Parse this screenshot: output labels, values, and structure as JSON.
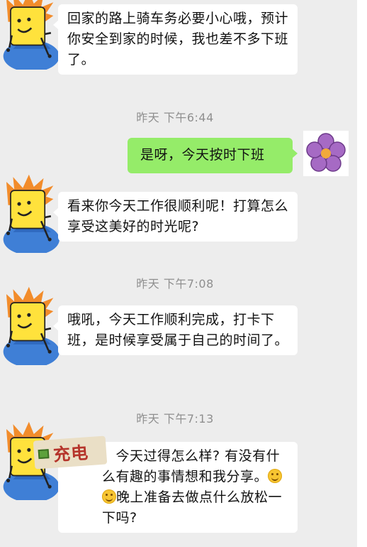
{
  "messages": [
    {
      "text": "回家的路上骑车务必要小心哦，预计你安全到家的时候，我也差不多下班了。"
    },
    {
      "text": "是呀，今天按时下班"
    },
    {
      "text": "看来你今天工作很顺利呢！打算怎么享受这美好的时光呢?"
    },
    {
      "text": "哦吼，今天工作顺利完成，打卡下班，是时候享受属于自己的时间了。"
    },
    {
      "text": "，今天过得怎么样? 有没有什么有趣的事情想和我分享。",
      "text_after": "晚上准备去做点什么放松一下吗?"
    }
  ],
  "timestamps": [
    "昨天 下午6:44",
    "昨天 下午7:08",
    "昨天 下午7:13"
  ],
  "sticker": {
    "text": "充电"
  },
  "icons": {
    "avatar_left": "cartoon-avatar-icon",
    "avatar_right": "purple-flower-avatar-icon",
    "emoji": "smile-emoji-icon"
  },
  "colors": {
    "background": "#ededed",
    "my_bubble": "#95ec69",
    "other_bubble": "#ffffff"
  }
}
